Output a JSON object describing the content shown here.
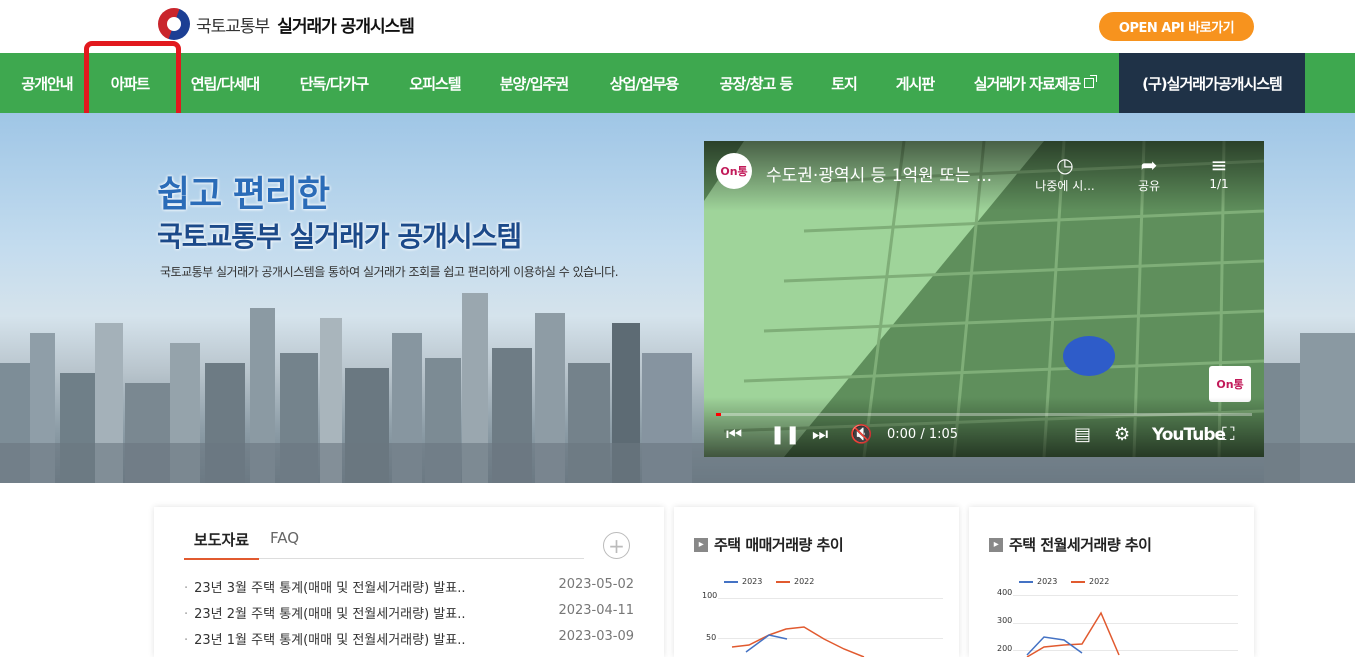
{
  "header": {
    "ministry": "국토교통부",
    "system_title": "실거래가 공개시스템",
    "open_api_label": "OPEN API 바로가기"
  },
  "nav": {
    "items": [
      "공개안내",
      "아파트",
      "연립/다세대",
      "단독/다가구",
      "오피스텔",
      "분양/입주권",
      "상업/업무용",
      "공장/창고 등",
      "토지",
      "게시판",
      "실거래가 자료제공"
    ],
    "old_system": "(구)실거래가공개시스템",
    "highlighted": "아파트"
  },
  "hero": {
    "line1": "쉽고 편리한",
    "line2": "국토교통부 실거래가 공개시스템",
    "description": "국토교통부 실거래가 공개시스템을 통하여 실거래가 조회를 쉽고 편리하게 이용하실 수 있습니다."
  },
  "video": {
    "channel_logo": "On통",
    "title": "수도권·광역시 등 1억원 또는 ...",
    "watch_later": "나중에 시...",
    "share": "공유",
    "playlist": "1/1",
    "time": "0:00 / 1:05",
    "brand": "YouTube",
    "progress": 0.01
  },
  "news_panel": {
    "tabs": [
      "보도자료",
      "FAQ"
    ],
    "more": "+",
    "items": [
      {
        "title": "23년 3월 주택 통계(매매 및 전월세거래량) 발표..",
        "date": "2023-05-02"
      },
      {
        "title": "23년 2월 주택 통계(매매 및 전월세거래량) 발표..",
        "date": "2023-04-11"
      },
      {
        "title": "23년 1월 주택 통계(매매 및 전월세거래량) 발표..",
        "date": "2023-03-09"
      }
    ]
  },
  "chart_panels": [
    {
      "title": "주택 매매거래량 추이",
      "legend": [
        "2023",
        "2022"
      ],
      "ticks": [
        "100",
        "50"
      ]
    },
    {
      "title": "주택 전월세거래량 추이",
      "legend": [
        "2023",
        "2022"
      ],
      "ticks": [
        "400",
        "300",
        "200"
      ]
    }
  ],
  "colors": {
    "nav_green": "#3ea84f",
    "old_system_bg": "#1f3247",
    "open_api_orange": "#f7931e",
    "highlight_red": "#e2191e",
    "series_2023": "#4472c4",
    "series_2022": "#e15a2f"
  }
}
